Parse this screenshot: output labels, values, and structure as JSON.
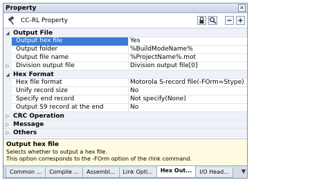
{
  "window": {
    "title": "Property",
    "close_label": "✕"
  },
  "header": {
    "label": "CC-RL Property"
  },
  "grid": {
    "categories": [
      {
        "name": "Output File",
        "expanded": true,
        "props": [
          {
            "name": "Output hex file",
            "value": "Yes",
            "selected": true
          },
          {
            "name": "Output folder",
            "value": "%BuildModeName%"
          },
          {
            "name": "Output file name",
            "value": "%ProjectName%.mot"
          },
          {
            "name": "Division output file",
            "value": "Division output file[0]",
            "expandable": true
          }
        ]
      },
      {
        "name": "Hex Format",
        "expanded": true,
        "props": [
          {
            "name": "Hex file format",
            "value": "Motorola S-record file(-FOrm=Stype)"
          },
          {
            "name": "Unify record size",
            "value": "No"
          },
          {
            "name": "Specify end record",
            "value": "Not specify(None)"
          },
          {
            "name": "Output S9 record at the end",
            "value": "No"
          }
        ]
      },
      {
        "name": "CRC Operation",
        "expanded": false,
        "props": []
      },
      {
        "name": "Message",
        "expanded": false,
        "props": []
      },
      {
        "name": "Others",
        "expanded": false,
        "props": []
      }
    ]
  },
  "description": {
    "title": "Output hex file",
    "line1": "Selects whether to output a hex file.",
    "line2": "This option corresponds to the -FOrm option of the rlink command."
  },
  "tabs": [
    {
      "label": "Common ...",
      "active": false
    },
    {
      "label": "Compile ...",
      "active": false
    },
    {
      "label": "Assembl...",
      "active": false
    },
    {
      "label": "Link Opti...",
      "active": false
    },
    {
      "label": "Hex Out...",
      "active": true
    },
    {
      "label": "I/O Head...",
      "active": false
    }
  ],
  "colors": {
    "selection": "#3b7bd4",
    "description_bg": "#fffbe0",
    "category_bg": "#eef2f8"
  }
}
